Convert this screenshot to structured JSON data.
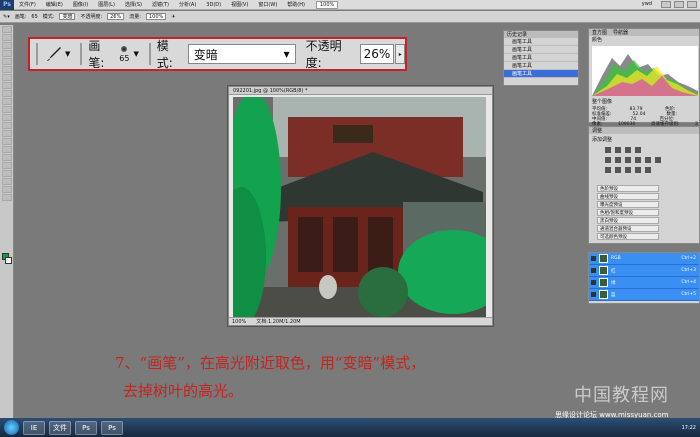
{
  "menubar": {
    "logo": "Ps",
    "items": [
      "文件(F)",
      "编辑(E)",
      "图像(I)",
      "图层(L)",
      "选择(S)",
      "滤镜(T)",
      "分析(A)",
      "3D(D)",
      "视图(V)",
      "窗口(W)",
      "帮助(H)"
    ],
    "zoom": "100%",
    "workspace": "ywd"
  },
  "optbar": {
    "brush_label": "画笔:",
    "brush_size": "65",
    "mode_label": "模式:",
    "mode_value": "变暗",
    "opacity_label": "不透明度:",
    "opacity_value": "26%",
    "flow_label": "流量:",
    "flow_value": "100%"
  },
  "zoom_options": {
    "brush_label": "画笔:",
    "brush_size": "65",
    "mode_label": "模式:",
    "mode_value": "变暗",
    "opacity_label": "不透明度:",
    "opacity_value": "26%"
  },
  "document": {
    "title": "092201.jpg @ 100%(RGB/8) *",
    "zoom": "100%",
    "info": "文档:1.20M/1.20M"
  },
  "history": {
    "tab": "历史记录",
    "rows": [
      "画笔工具",
      "画笔工具",
      "画笔工具",
      "画笔工具",
      "画笔工具"
    ]
  },
  "histogram": {
    "tab": "直方图",
    "tab2": "导航器",
    "channel": "颜色",
    "source": "整个图像",
    "stats": [
      {
        "label": "平均值:",
        "value": "83.79",
        "label2": "色阶:",
        "value2": ""
      },
      {
        "label": "标准偏差:",
        "value": "52.04",
        "label2": "数量:",
        "value2": ""
      },
      {
        "label": "中间值:",
        "value": "74",
        "label2": "百分位:",
        "value2": ""
      },
      {
        "label": "像素:",
        "value": "109030",
        "label2": "高速缓存级别:",
        "value2": "2"
      }
    ]
  },
  "adjustments": {
    "tab": "调整",
    "heading": "添加调整",
    "presets": [
      "色阶预设",
      "曲线预设",
      "曝光度预设",
      "色相/饱和度预设",
      "黑白预设",
      "通道混合器预设",
      "可选颜色预设"
    ]
  },
  "layers": {
    "rows": [
      {
        "name": "RGB",
        "shortcut": "Ctrl+2"
      },
      {
        "name": "红",
        "shortcut": "Ctrl+3"
      },
      {
        "name": "绿",
        "shortcut": "Ctrl+4"
      },
      {
        "name": "蓝",
        "shortcut": "Ctrl+5"
      }
    ]
  },
  "caption": {
    "line1": "7、“画笔”，在高光附近取色，用“变暗”模式，",
    "line2": "去掉树叶的高光。"
  },
  "watermark": {
    "main": "中国教程网",
    "sub": "思缘设计论坛 www.missyuan.com"
  },
  "taskbar": {
    "apps": [
      "IE",
      "文件",
      "Ps",
      "Ps"
    ],
    "clock": "17:22"
  },
  "colors": {
    "accent_border": "#c8202a",
    "caption": "#c4241f",
    "foreground": "#08a13a",
    "layer_selected": "#3a8ff2"
  }
}
